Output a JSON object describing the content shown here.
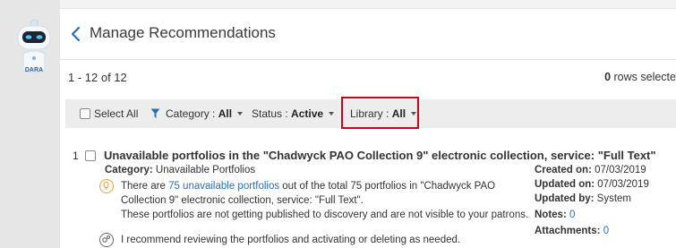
{
  "sidebar": {
    "logo_text": "DARA",
    "icon": "robot-icon"
  },
  "header": {
    "title": "Manage Recommendations",
    "back_icon": "chevron-left-icon"
  },
  "results": {
    "count_text": "1 - 12 of 12",
    "rows_selected_count": "0",
    "rows_selected_label": "rows selecte"
  },
  "filters": {
    "select_all_label": "Select All",
    "filter_icon": "filter-icon",
    "category_label": "Category :",
    "category_value": "All",
    "status_label": "Status :",
    "status_value": "Active",
    "library_label": "Library :",
    "library_value": "All"
  },
  "recommendation": {
    "number": "1",
    "title": "Unavailable portfolios in the \"Chadwyck PAO Collection 9\" electronic collection, service: \"Full Text\"",
    "category_label": "Category:",
    "category_value": "Unavailable Portfolios",
    "line1_pre": "There are ",
    "line1_link": "75 unavailable portfolios",
    "line1_post": " out of the total 75 portfolios in \"Chadwyck PAO",
    "line2": "Collection 9\" electronic collection, service: \"Full Text\".",
    "line3": "These portfolios are not getting published to discovery and are not visible to your patrons.",
    "line4": "I recommend reviewing the portfolios and activating or deleting as needed.",
    "created_label": "Created on:",
    "created_value": "07/03/2019",
    "updated_label": "Updated on:",
    "updated_value": "07/03/2019",
    "updated_by_label": "Updated by:",
    "updated_by_value": "System",
    "notes_label": "Notes:",
    "notes_value": "0",
    "attachments_label": "Attachments:",
    "attachments_value": "0"
  },
  "colors": {
    "accent": "#2a6ebb",
    "highlight": "#d0021b",
    "sidebar_bg": "#e6e6e6",
    "filter_bar_bg": "#ededed",
    "bulb": "#e4a23a"
  }
}
